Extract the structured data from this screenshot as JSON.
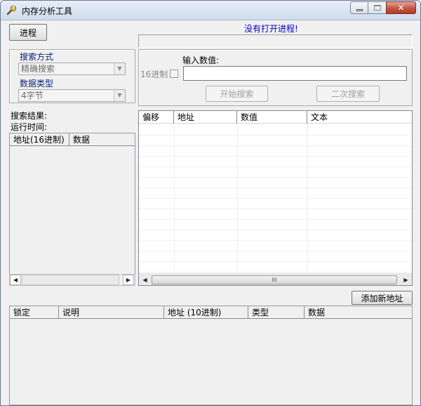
{
  "window": {
    "title": "内存分析工具",
    "icon": "wrench-icon",
    "caption": {
      "minimize": "minimize",
      "maximize": "maximize",
      "close": "close"
    }
  },
  "toolbar": {
    "process_button": "进程",
    "status": "没有打开进程!"
  },
  "search_settings": {
    "search_mode_label": "搜索方式",
    "search_mode_value": "精确搜索",
    "data_type_label": "数据类型",
    "data_type_value": "4字节"
  },
  "value_input": {
    "hex_label": "16进制",
    "input_label": "输入数值:",
    "input_value": "",
    "start_search": "开始搜索",
    "second_search": "二次搜索"
  },
  "results_info": {
    "result_label": "搜索结果:",
    "runtime_label": "运行时间:"
  },
  "result_list": {
    "columns": [
      "地址(16进制)",
      "数据"
    ]
  },
  "memory_view": {
    "columns": [
      "偏移",
      "地址",
      "数值",
      "文本"
    ],
    "scroll_grip": "III"
  },
  "saved_list": {
    "add_button": "添加新地址",
    "columns": [
      "锁定",
      "说明",
      "地址 (10进制)",
      "类型",
      "数据"
    ]
  },
  "colors": {
    "status_text": "#0000cc",
    "label_blue": "#0b237a",
    "disabled_text": "#a0a0a0",
    "background": "#f0f0f0"
  }
}
